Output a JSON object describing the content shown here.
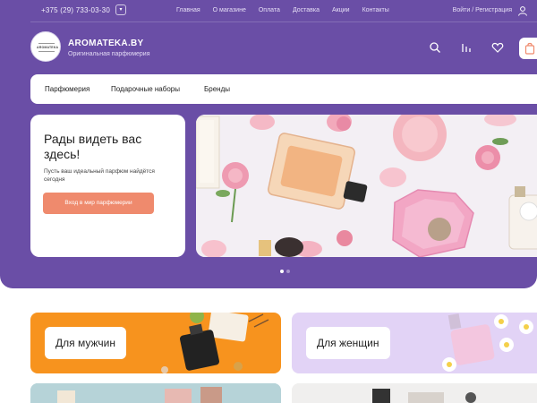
{
  "topbar": {
    "phone": "+375 (29) 733-03-30",
    "nav": [
      "Главная",
      "О магазине",
      "Оплата",
      "Доставка",
      "Акции",
      "Контакты"
    ],
    "login": "Войти / Регистрация"
  },
  "header": {
    "logo_text": "AROMATEKA",
    "brand": "AROMATEKA.BY",
    "tagline": "Оригинальная парфюмерия"
  },
  "catnav": [
    "Парфюмерия",
    "Подарочные наборы",
    "Бренды"
  ],
  "welcome": {
    "title": "Рады видеть вас здесь!",
    "text": "Пусть ваш идеальный парфюм найдётся сегодня",
    "cta": "Вход в мир парфюмерии"
  },
  "slider": {
    "slides": 2,
    "active": 1
  },
  "tiles": [
    {
      "label": "Для мужчин",
      "color": "#f7931e"
    },
    {
      "label": "Для женщин",
      "color": "#e2d3f6"
    }
  ],
  "colors": {
    "brand_purple": "#6a4ea6",
    "accent": "#ef8a6d"
  }
}
